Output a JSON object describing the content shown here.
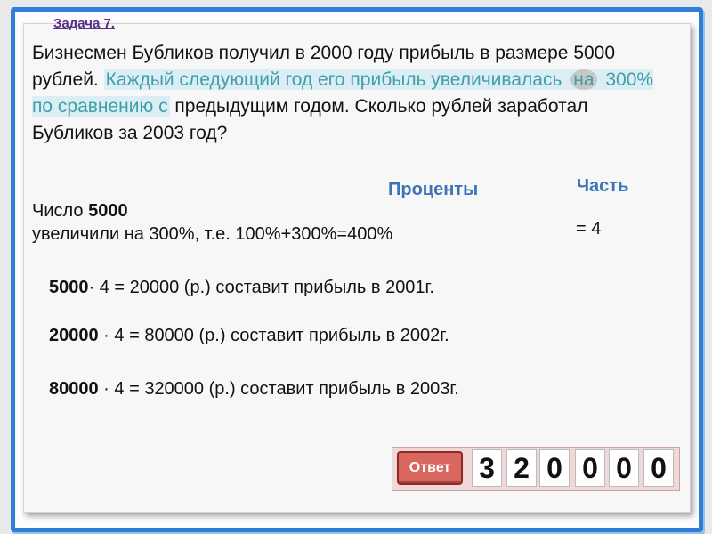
{
  "task_label": "Задача 7.",
  "problem": {
    "part1": "Бизнесмен Бубликов получил в 2000 году прибыль в размере 5000 рублей. ",
    "hl_a": "Каждый следующий год его прибыль увеличивалась ",
    "hl_circled": "на",
    "hl_b": " 300% по сравнению с",
    "part2": " предыдущим годом. Сколько рублей заработал Бубликов за 2003 год?"
  },
  "headers": {
    "percent": "Проценты",
    "part": "Часть"
  },
  "number_line": {
    "prefix": "Число ",
    "value": "5000"
  },
  "increase_line": "увеличили на 300%, т.е. 100%+300%=400%",
  "part_value": "= 4",
  "calculations": [
    {
      "bold": "5000",
      "rest": "· 4 = 20000  (р.)  составит прибыль в 2001г."
    },
    {
      "bold": "20000",
      "rest": " · 4 = 80000  (р.)  составит прибыль в 2002г."
    },
    {
      "bold": "80000",
      "rest": " · 4 = 320000  (р.)  составит прибыль в 2003г."
    }
  ],
  "answer": {
    "label": "Ответ",
    "digits": [
      "3",
      "2",
      "0",
      "0",
      "0",
      "0"
    ]
  },
  "colors": {
    "frame": "#2e7fd8",
    "task_label": "#5a2d86",
    "highlight_text": "#3f9fa9",
    "headers": "#3c74b8",
    "answer_button": "#d9665f"
  }
}
